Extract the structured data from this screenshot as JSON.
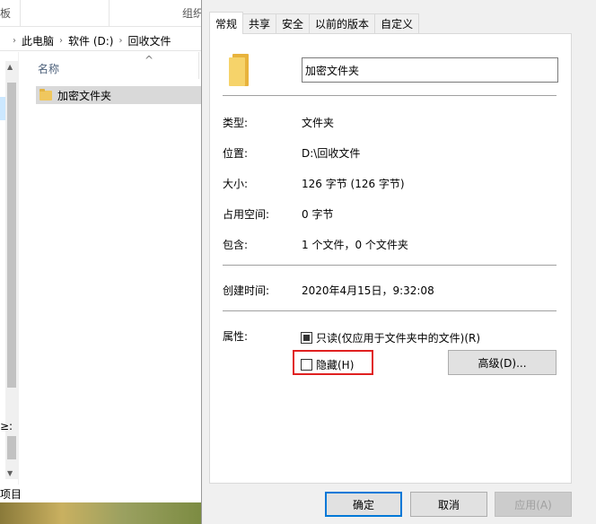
{
  "explorer": {
    "ribbon_left": "板",
    "ribbon_organize": "组织",
    "breadcrumb": [
      "此电脑",
      "软件 (D:)",
      "回收文件"
    ],
    "nav_cut_label": "≥:",
    "column_name": "名称",
    "file_name": "加密文件夹",
    "status_items": "项目"
  },
  "dialog": {
    "tabs": [
      "常规",
      "共享",
      "安全",
      "以前的版本",
      "自定义"
    ],
    "active_tab": "常规",
    "folder_name": "加密文件夹",
    "props": {
      "type_label": "类型:",
      "type_value": "文件夹",
      "location_label": "位置:",
      "location_value": "D:\\回收文件",
      "size_label": "大小:",
      "size_value": "126 字节 (126 字节)",
      "disk_label": "占用空间:",
      "disk_value": "0 字节",
      "contains_label": "包含:",
      "contains_value": "1 个文件，0 个文件夹",
      "created_label": "创建时间:",
      "created_value": "2020年4月15日，9:32:08"
    },
    "attributes": {
      "label": "属性:",
      "readonly_label": "只读(仅应用于文件夹中的文件)(R)",
      "readonly_state": "indeterminate",
      "hidden_label": "隐藏(H)",
      "hidden_state": "unchecked",
      "advanced_label": "高级(D)..."
    },
    "buttons": {
      "ok": "确定",
      "cancel": "取消",
      "apply": "应用(A)"
    },
    "highlight_color": "#e02020"
  }
}
